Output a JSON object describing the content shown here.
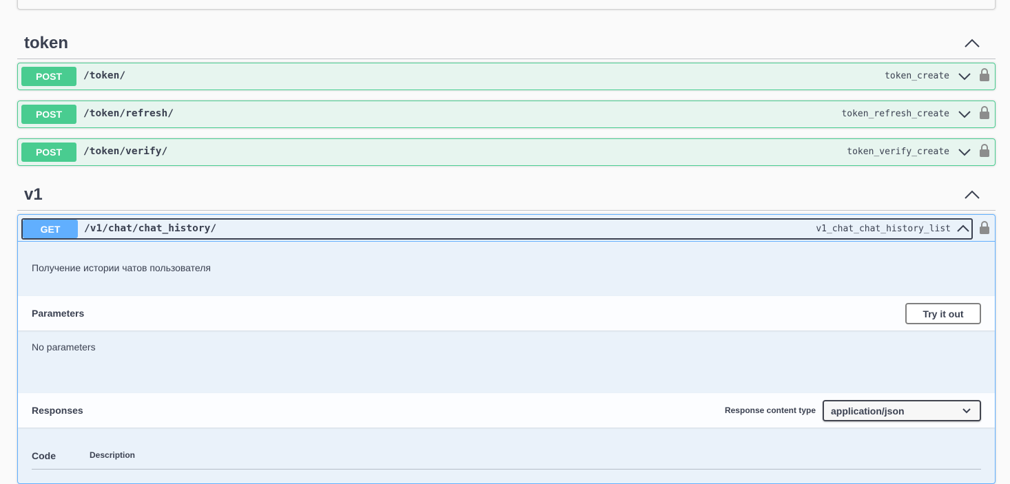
{
  "sections": {
    "token": {
      "title": "token",
      "operations": [
        {
          "method": "POST",
          "path": "/token/",
          "operation_id": "token_create"
        },
        {
          "method": "POST",
          "path": "/token/refresh/",
          "operation_id": "token_refresh_create"
        },
        {
          "method": "POST",
          "path": "/token/verify/",
          "operation_id": "token_verify_create"
        }
      ]
    },
    "v1": {
      "title": "v1",
      "operation": {
        "method": "GET",
        "path": "/v1/chat/chat_history/",
        "operation_id": "v1_chat_chat_history_list",
        "description": "Получение истории чатов пользователя",
        "parameters_title": "Parameters",
        "try_button": "Try it out",
        "no_parameters": "No parameters",
        "responses_title": "Responses",
        "response_content_type_label": "Response content type",
        "response_content_type_value": "application/json",
        "columns": {
          "code": "Code",
          "description": "Description"
        }
      }
    }
  },
  "colors": {
    "post": "#49cc90",
    "get": "#61affe",
    "text": "#3b4151"
  },
  "icons": {
    "collapse": "chevron-up-icon",
    "expand": "chevron-down-icon",
    "lock": "lock-icon"
  }
}
